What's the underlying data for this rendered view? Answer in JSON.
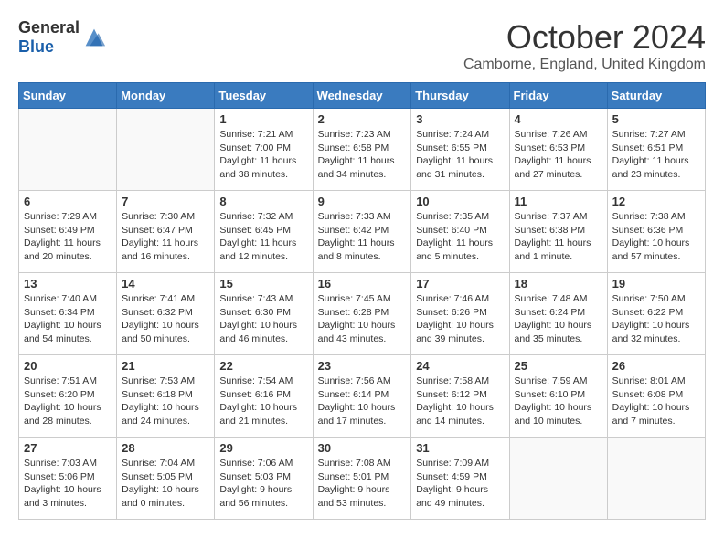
{
  "header": {
    "logo_general": "General",
    "logo_blue": "Blue",
    "title": "October 2024",
    "location": "Camborne, England, United Kingdom"
  },
  "days_of_week": [
    "Sunday",
    "Monday",
    "Tuesday",
    "Wednesday",
    "Thursday",
    "Friday",
    "Saturday"
  ],
  "weeks": [
    [
      {
        "day": "",
        "empty": true
      },
      {
        "day": "",
        "empty": true
      },
      {
        "day": "1",
        "sunrise": "Sunrise: 7:21 AM",
        "sunset": "Sunset: 7:00 PM",
        "daylight": "Daylight: 11 hours and 38 minutes."
      },
      {
        "day": "2",
        "sunrise": "Sunrise: 7:23 AM",
        "sunset": "Sunset: 6:58 PM",
        "daylight": "Daylight: 11 hours and 34 minutes."
      },
      {
        "day": "3",
        "sunrise": "Sunrise: 7:24 AM",
        "sunset": "Sunset: 6:55 PM",
        "daylight": "Daylight: 11 hours and 31 minutes."
      },
      {
        "day": "4",
        "sunrise": "Sunrise: 7:26 AM",
        "sunset": "Sunset: 6:53 PM",
        "daylight": "Daylight: 11 hours and 27 minutes."
      },
      {
        "day": "5",
        "sunrise": "Sunrise: 7:27 AM",
        "sunset": "Sunset: 6:51 PM",
        "daylight": "Daylight: 11 hours and 23 minutes."
      }
    ],
    [
      {
        "day": "6",
        "sunrise": "Sunrise: 7:29 AM",
        "sunset": "Sunset: 6:49 PM",
        "daylight": "Daylight: 11 hours and 20 minutes."
      },
      {
        "day": "7",
        "sunrise": "Sunrise: 7:30 AM",
        "sunset": "Sunset: 6:47 PM",
        "daylight": "Daylight: 11 hours and 16 minutes."
      },
      {
        "day": "8",
        "sunrise": "Sunrise: 7:32 AM",
        "sunset": "Sunset: 6:45 PM",
        "daylight": "Daylight: 11 hours and 12 minutes."
      },
      {
        "day": "9",
        "sunrise": "Sunrise: 7:33 AM",
        "sunset": "Sunset: 6:42 PM",
        "daylight": "Daylight: 11 hours and 8 minutes."
      },
      {
        "day": "10",
        "sunrise": "Sunrise: 7:35 AM",
        "sunset": "Sunset: 6:40 PM",
        "daylight": "Daylight: 11 hours and 5 minutes."
      },
      {
        "day": "11",
        "sunrise": "Sunrise: 7:37 AM",
        "sunset": "Sunset: 6:38 PM",
        "daylight": "Daylight: 11 hours and 1 minute."
      },
      {
        "day": "12",
        "sunrise": "Sunrise: 7:38 AM",
        "sunset": "Sunset: 6:36 PM",
        "daylight": "Daylight: 10 hours and 57 minutes."
      }
    ],
    [
      {
        "day": "13",
        "sunrise": "Sunrise: 7:40 AM",
        "sunset": "Sunset: 6:34 PM",
        "daylight": "Daylight: 10 hours and 54 minutes."
      },
      {
        "day": "14",
        "sunrise": "Sunrise: 7:41 AM",
        "sunset": "Sunset: 6:32 PM",
        "daylight": "Daylight: 10 hours and 50 minutes."
      },
      {
        "day": "15",
        "sunrise": "Sunrise: 7:43 AM",
        "sunset": "Sunset: 6:30 PM",
        "daylight": "Daylight: 10 hours and 46 minutes."
      },
      {
        "day": "16",
        "sunrise": "Sunrise: 7:45 AM",
        "sunset": "Sunset: 6:28 PM",
        "daylight": "Daylight: 10 hours and 43 minutes."
      },
      {
        "day": "17",
        "sunrise": "Sunrise: 7:46 AM",
        "sunset": "Sunset: 6:26 PM",
        "daylight": "Daylight: 10 hours and 39 minutes."
      },
      {
        "day": "18",
        "sunrise": "Sunrise: 7:48 AM",
        "sunset": "Sunset: 6:24 PM",
        "daylight": "Daylight: 10 hours and 35 minutes."
      },
      {
        "day": "19",
        "sunrise": "Sunrise: 7:50 AM",
        "sunset": "Sunset: 6:22 PM",
        "daylight": "Daylight: 10 hours and 32 minutes."
      }
    ],
    [
      {
        "day": "20",
        "sunrise": "Sunrise: 7:51 AM",
        "sunset": "Sunset: 6:20 PM",
        "daylight": "Daylight: 10 hours and 28 minutes."
      },
      {
        "day": "21",
        "sunrise": "Sunrise: 7:53 AM",
        "sunset": "Sunset: 6:18 PM",
        "daylight": "Daylight: 10 hours and 24 minutes."
      },
      {
        "day": "22",
        "sunrise": "Sunrise: 7:54 AM",
        "sunset": "Sunset: 6:16 PM",
        "daylight": "Daylight: 10 hours and 21 minutes."
      },
      {
        "day": "23",
        "sunrise": "Sunrise: 7:56 AM",
        "sunset": "Sunset: 6:14 PM",
        "daylight": "Daylight: 10 hours and 17 minutes."
      },
      {
        "day": "24",
        "sunrise": "Sunrise: 7:58 AM",
        "sunset": "Sunset: 6:12 PM",
        "daylight": "Daylight: 10 hours and 14 minutes."
      },
      {
        "day": "25",
        "sunrise": "Sunrise: 7:59 AM",
        "sunset": "Sunset: 6:10 PM",
        "daylight": "Daylight: 10 hours and 10 minutes."
      },
      {
        "day": "26",
        "sunrise": "Sunrise: 8:01 AM",
        "sunset": "Sunset: 6:08 PM",
        "daylight": "Daylight: 10 hours and 7 minutes."
      }
    ],
    [
      {
        "day": "27",
        "sunrise": "Sunrise: 7:03 AM",
        "sunset": "Sunset: 5:06 PM",
        "daylight": "Daylight: 10 hours and 3 minutes."
      },
      {
        "day": "28",
        "sunrise": "Sunrise: 7:04 AM",
        "sunset": "Sunset: 5:05 PM",
        "daylight": "Daylight: 10 hours and 0 minutes."
      },
      {
        "day": "29",
        "sunrise": "Sunrise: 7:06 AM",
        "sunset": "Sunset: 5:03 PM",
        "daylight": "Daylight: 9 hours and 56 minutes."
      },
      {
        "day": "30",
        "sunrise": "Sunrise: 7:08 AM",
        "sunset": "Sunset: 5:01 PM",
        "daylight": "Daylight: 9 hours and 53 minutes."
      },
      {
        "day": "31",
        "sunrise": "Sunrise: 7:09 AM",
        "sunset": "Sunset: 4:59 PM",
        "daylight": "Daylight: 9 hours and 49 minutes."
      },
      {
        "day": "",
        "empty": true
      },
      {
        "day": "",
        "empty": true
      }
    ]
  ]
}
